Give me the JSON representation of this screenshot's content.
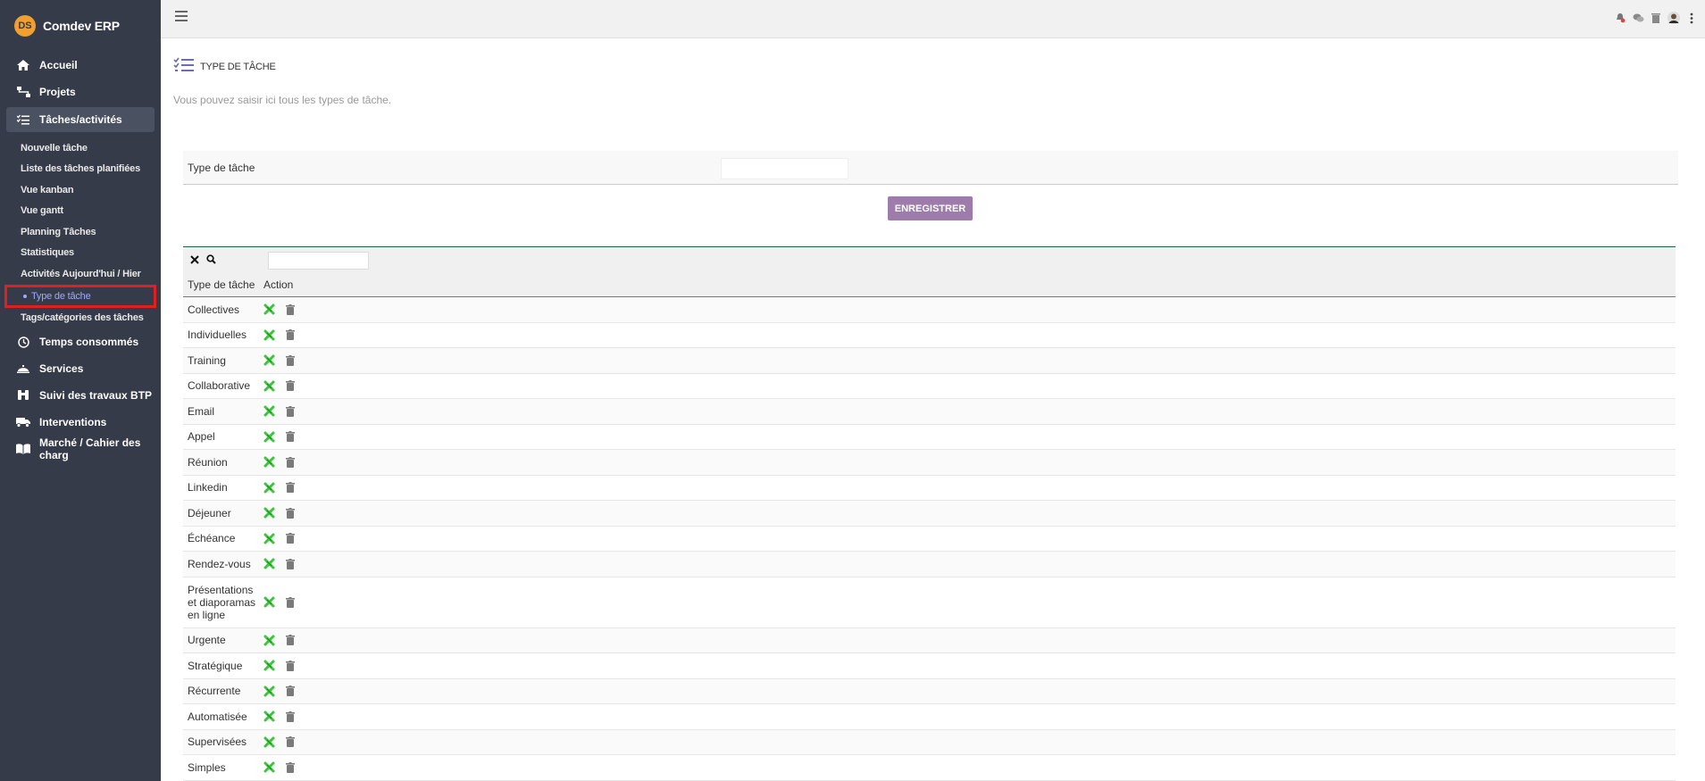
{
  "brand": {
    "name": "Comdev ERP",
    "logo_text": "DS"
  },
  "sidebar": {
    "items": [
      {
        "label": "Accueil",
        "icon": "home-icon"
      },
      {
        "label": "Projets",
        "icon": "project-tree-icon"
      },
      {
        "label": "Tâches/activités",
        "icon": "task-list-icon",
        "active": true
      },
      {
        "label": "Temps consommés",
        "icon": "clock-icon"
      },
      {
        "label": "Services",
        "icon": "services-icon"
      },
      {
        "label": "Suivi des travaux BTP",
        "icon": "binoculars-icon"
      },
      {
        "label": "Interventions",
        "icon": "truck-icon"
      },
      {
        "label": "Marché / Cahier des charg",
        "icon": "book-icon"
      }
    ],
    "sub_items": [
      {
        "label": "Nouvelle tâche"
      },
      {
        "label": "Liste des tâches planifiées"
      },
      {
        "label": "Vue kanban"
      },
      {
        "label": "Vue gantt"
      },
      {
        "label": "Planning Tâches"
      },
      {
        "label": "Statistiques"
      },
      {
        "label": "Activités Aujourd'hui / Hier"
      },
      {
        "label": "Type de tâche",
        "current": true
      },
      {
        "label": "Tags/catégories des tâches"
      }
    ]
  },
  "topbar": {
    "icons": [
      "bell-icon",
      "chat-icon",
      "trash-icon",
      "avatar-icon",
      "more-icon"
    ]
  },
  "page": {
    "title": "TYPE DE TÂCHE",
    "description": "Vous pouvez saisir ici tous les types de tâche."
  },
  "form": {
    "label": "Type de tâche",
    "input_value": "",
    "save_label": "ENREGISTRER"
  },
  "table": {
    "filter_value": "",
    "headers": [
      "Type de tâche",
      "Action"
    ],
    "rows": [
      "Collectives",
      "Individuelles",
      "Training",
      "Collaborative",
      "Email",
      "Appel",
      "Réunion",
      "Linkedin",
      "Déjeuner",
      "Échéance",
      "Rendez-vous",
      "Présentations et diaporamas en ligne",
      "Urgente",
      "Stratégique",
      "Récurrente",
      "Automatisée",
      "Supervisées",
      "Simples"
    ]
  },
  "colors": {
    "sidebar_bg": "#353b48",
    "accent_button": "#9d7bab",
    "edit_icon": "#3cc43c",
    "highlight_border": "#e02020"
  }
}
